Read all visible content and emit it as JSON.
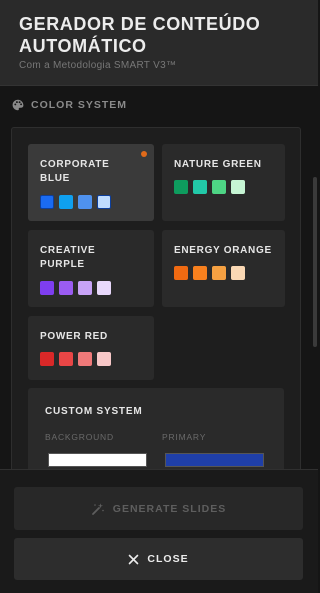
{
  "header": {
    "title": "GERADOR DE CONTEÚDO AUTOMÁTICO",
    "subtitle": "Com a Metodologia SMART V3™"
  },
  "section": {
    "title": "COLOR SYSTEM",
    "icon": "palette-icon"
  },
  "color_systems": [
    {
      "name": "CORPORATE BLUE",
      "selected": true,
      "indicator_color": "#e06a1a",
      "swatches": [
        "#1a6bf2",
        "#0fa0f0",
        "#4f92ee",
        "#bfdcff"
      ]
    },
    {
      "name": "NATURE GREEN",
      "selected": false,
      "swatches": [
        "#0e9c5e",
        "#22c9a8",
        "#4ed585",
        "#c6f5d4"
      ]
    },
    {
      "name": "CREATIVE PURPLE",
      "selected": false,
      "swatches": [
        "#7e3ef0",
        "#9b5cf2",
        "#c8a3f7",
        "#e8d8fb"
      ]
    },
    {
      "name": "ENERGY ORANGE",
      "selected": false,
      "swatches": [
        "#f06a12",
        "#f7801e",
        "#f6a142",
        "#fad8b4"
      ]
    },
    {
      "name": "POWER RED",
      "selected": false,
      "swatches": [
        "#d92828",
        "#e94646",
        "#f07a7a",
        "#f8c8c8"
      ]
    }
  ],
  "custom_system": {
    "title": "CUSTOM SYSTEM",
    "background_label": "BACKGROUND",
    "background_value": "#ffffff",
    "primary_label": "PRIMARY",
    "primary_value": "#1f3fa8"
  },
  "buttons": {
    "generate_label": "GENERATE SLIDES",
    "close_label": "CLOSE"
  }
}
